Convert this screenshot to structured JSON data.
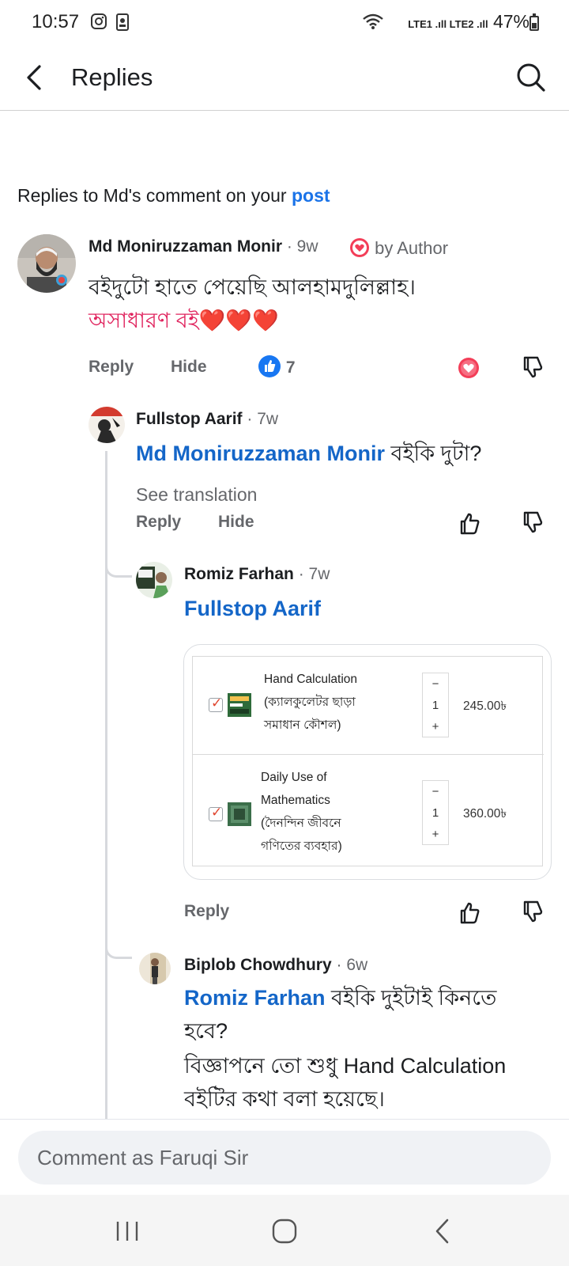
{
  "status_bar": {
    "time": "10:57",
    "network": "LTE1 .ıll LTE2 .ıll",
    "battery": "47%"
  },
  "header": {
    "title": "Replies"
  },
  "context": {
    "prefix": "Replies to Md's comment on your ",
    "link": "post"
  },
  "comments": [
    {
      "author": "Md Moniruzzaman Monir",
      "time": "· 9w",
      "badge": "by Author",
      "text_line1": "বইদুটো হাতে পেয়েছি আলহামদুলিল্লাহ।",
      "text_line2": "অসাধারণ বই❤️❤️❤️",
      "reply": "Reply",
      "hide": "Hide",
      "like_count": "7"
    },
    {
      "author": "Fullstop Aarif",
      "time": "· 7w",
      "mention": "Md Moniruzzaman Monir",
      "text": " বইকি দুটা?",
      "see_translation": "See translation",
      "reply": "Reply",
      "hide": "Hide"
    },
    {
      "author": "Romiz Farhan",
      "time": "· 7w",
      "mention": "Fullstop Aarif",
      "reply": "Reply",
      "cart": [
        {
          "name_line1": "Hand Calculation",
          "name_line2": "(ক্যালকুলেটর ছাড়া",
          "name_line3": "সমাধান কৌশল)",
          "qty": "1",
          "minus": "−",
          "plus": "+",
          "price": "245.00৳"
        },
        {
          "name_line1": "Daily Use of",
          "name_line2": "Mathematics",
          "name_line3": "(দৈনন্দিন জীবনে",
          "name_line4": "গণিতের ব্যবহার)",
          "qty": "1",
          "minus": "−",
          "plus": "+",
          "price": "360.00৳"
        }
      ]
    },
    {
      "author": "Biplob Chowdhury",
      "time": "· 6w",
      "mention": "Romiz Farhan",
      "text_line1": " বইকি দুইটাই কিনতে",
      "text_line2": "হবে?",
      "text_line3": "বিজ্ঞাপনে তো শুধু Hand Calculation",
      "text_line4": "বইটির কথা বলা হয়েছে।"
    }
  ],
  "composer": {
    "placeholder": "Comment as Faruqi Sir"
  },
  "colors": {
    "link": "#1a73e8",
    "mention": "#1466c8",
    "like_blue": "#1877f2",
    "love_red": "#f33e58"
  }
}
